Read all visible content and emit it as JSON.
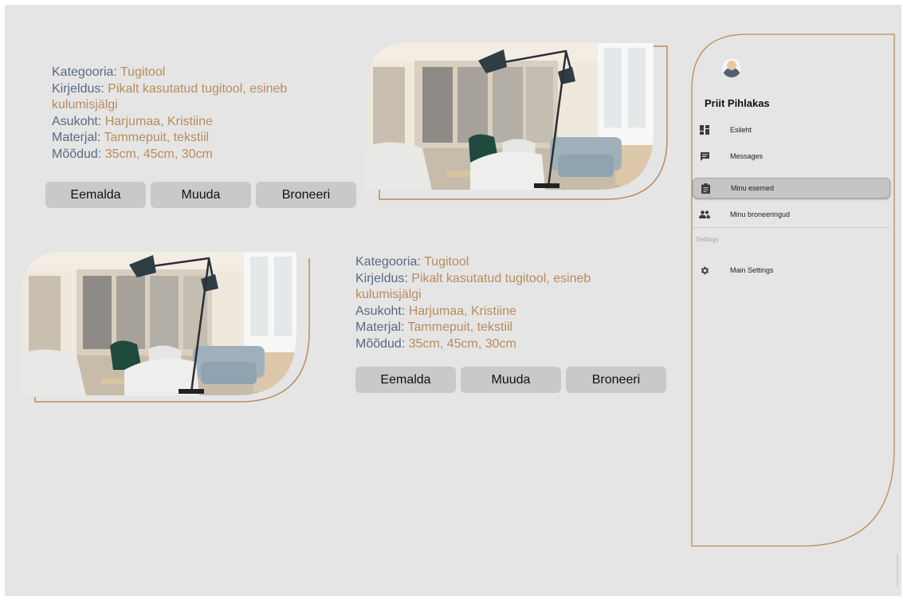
{
  "listings": [
    {
      "fields": [
        {
          "label": "Kategooria:",
          "value": "Tugitool"
        },
        {
          "label": "Kirjeldus:",
          "value": "Pikalt kasutatud tugitool, esineb kulumisjälgi"
        },
        {
          "label": "Asukoht:",
          "value": "Harjumaa, Kristiine"
        },
        {
          "label": "Materjal:",
          "value": "Tammepuit, tekstiil"
        },
        {
          "label": "Mõõdud:",
          "value": "35cm, 45cm, 30cm"
        }
      ],
      "buttons": {
        "remove": "Eemalda",
        "edit": "Muuda",
        "book": "Broneeri"
      }
    },
    {
      "fields": [
        {
          "label": "Kategooria:",
          "value": "Tugitool"
        },
        {
          "label": "Kirjeldus:",
          "value": "Pikalt kasutatud tugitool, esineb kulumisjälgi"
        },
        {
          "label": "Asukoht:",
          "value": "Harjumaa, Kristiine"
        },
        {
          "label": "Materjal:",
          "value": "Tammepuit, tekstiil"
        },
        {
          "label": "Mõõdud:",
          "value": "35cm, 45cm, 30cm"
        }
      ],
      "buttons": {
        "remove": "Eemalda",
        "edit": "Muuda",
        "book": "Broneeri"
      }
    }
  ],
  "sidebar": {
    "user_name": "Priit Pihlakas",
    "items": [
      {
        "label": "Esileht",
        "icon": "dashboard-icon"
      },
      {
        "label": "Messages",
        "icon": "message-icon"
      },
      {
        "label": "Minu esemed",
        "icon": "clipboard-icon"
      },
      {
        "label": "Minu broneeringud",
        "icon": "people-icon"
      }
    ],
    "settings_label": "Settings",
    "settings_items": [
      {
        "label": "Main Settings",
        "icon": "gear-icon"
      }
    ]
  },
  "colors": {
    "background": "#e5e5e5",
    "accent": "#b98c5c",
    "label": "#5a6a82",
    "button": "#c9c9c9"
  }
}
